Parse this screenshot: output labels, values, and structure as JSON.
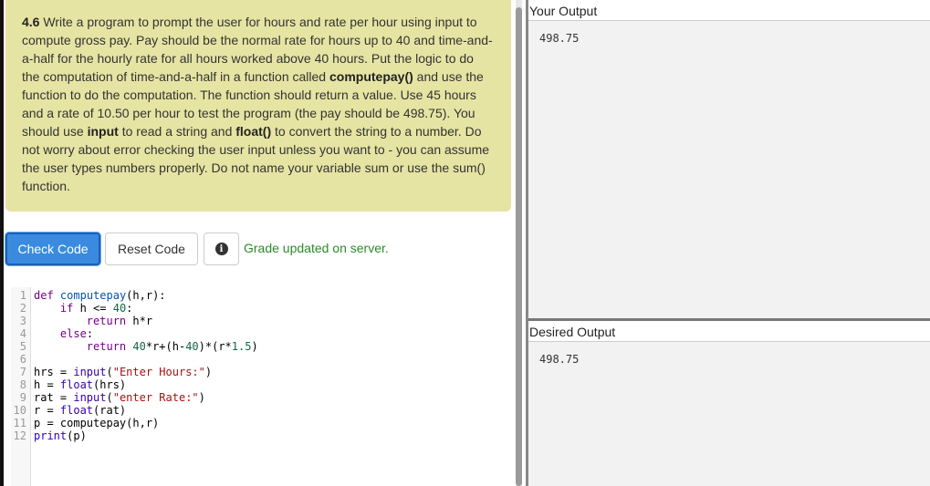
{
  "prompt": {
    "number": "4.6",
    "segments": [
      " Write a program to prompt the user for hours and rate per hour using input to compute gross pay. Pay should be the normal rate for hours up to 40 and time-and-a-half for the hourly rate for all hours worked above 40 hours. Put the logic to do the computation of time-and-a-half in a function called ",
      "computepay()",
      " and use the function to do the computation. The function should return a value. Use 45 hours and a rate of 10.50 per hour to test the program (the pay should be 498.75). You should use ",
      "input",
      " to read a string and ",
      "float()",
      " to convert the string to a number. Do not worry about error checking the user input unless you want to - you can assume the user types numbers properly. Do not name your variable sum or use the sum() function."
    ]
  },
  "toolbar": {
    "check_label": "Check Code",
    "reset_label": "Reset Code",
    "info_icon": "i",
    "status": "Grade updated on server."
  },
  "editor": {
    "lines": [
      {
        "n": "1",
        "text": "def computepay(h,r):"
      },
      {
        "n": "2",
        "text": "    if h <= 40:"
      },
      {
        "n": "3",
        "text": "        return h*r"
      },
      {
        "n": "4",
        "text": "    else:"
      },
      {
        "n": "5",
        "text": "        return 40*r+(h-40)*(r*1.5)"
      },
      {
        "n": "6",
        "text": ""
      },
      {
        "n": "7",
        "text": "hrs = input(\"Enter Hours:\")"
      },
      {
        "n": "8",
        "text": "h = float(hrs)"
      },
      {
        "n": "9",
        "text": "rat = input(\"enter Rate:\")"
      },
      {
        "n": "10",
        "text": "r = float(rat)"
      },
      {
        "n": "11",
        "text": "p = computepay(h,r)"
      },
      {
        "n": "12",
        "text": "print(p)"
      }
    ]
  },
  "output": {
    "your_title": "Your Output",
    "your_value": "498.75",
    "desired_title": "Desired Output",
    "desired_value": "498.75"
  }
}
